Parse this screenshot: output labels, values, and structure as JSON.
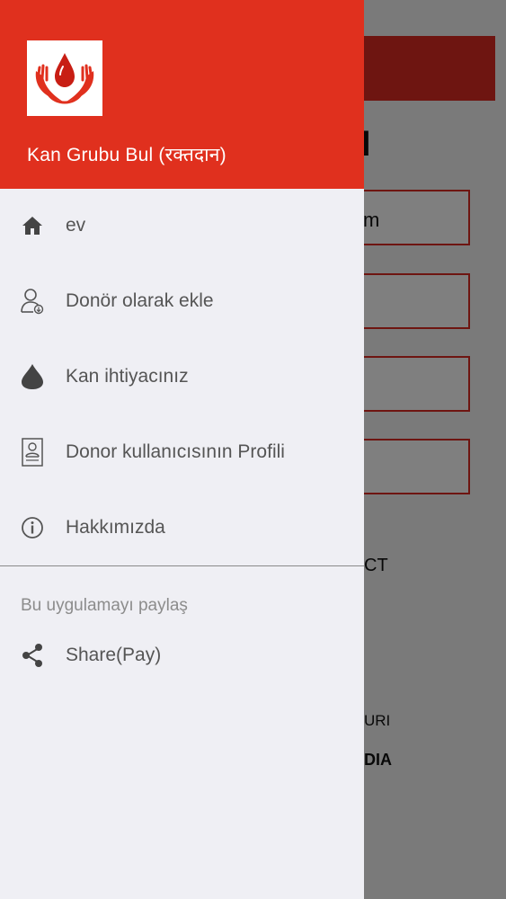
{
  "app": {
    "title": "Kan Grubu Bul (रक्तदान)"
  },
  "menu": [
    {
      "label": "ev",
      "icon": "home-icon"
    },
    {
      "label": "Donör olarak ekle",
      "icon": "add-person-icon"
    },
    {
      "label": "Kan ihtiyacınız",
      "icon": "blood-drop-icon"
    },
    {
      "label": "Donor kullanıcısının Profili",
      "icon": "profile-card-icon"
    },
    {
      "label": "Hakkımızda",
      "icon": "info-icon"
    }
  ],
  "share_section": {
    "label": "Bu uygulamayı paylaş",
    "item": {
      "label": "Share(Pay)",
      "icon": "share-icon"
    }
  },
  "background": {
    "heading": "l",
    "field_text": "m",
    "text_1": "CT",
    "text_2": "URI",
    "text_3": "DIA"
  },
  "colors": {
    "accent": "#e0301e",
    "drawer_bg": "#efeff4",
    "menu_text": "#555555"
  }
}
